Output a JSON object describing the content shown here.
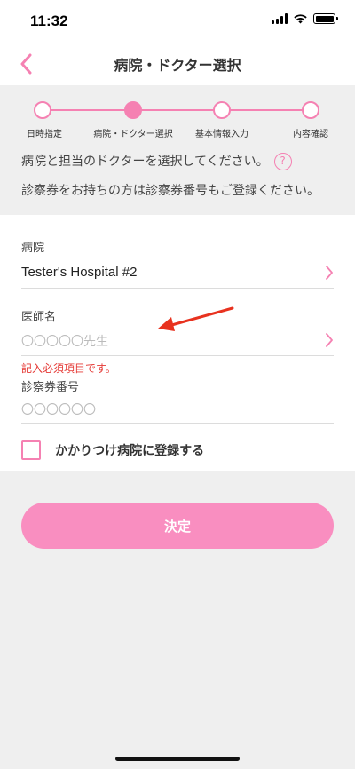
{
  "status_bar": {
    "time": "11:32"
  },
  "nav": {
    "title": "病院・ドクター選択"
  },
  "steps": [
    {
      "label": "日時指定",
      "active": false
    },
    {
      "label": "病院・ドクター選択",
      "active": true
    },
    {
      "label": "基本情報入力",
      "active": false
    },
    {
      "label": "内容確認",
      "active": false
    }
  ],
  "intro": {
    "line1": "病院と担当のドクターを選択してください。",
    "help_symbol": "?",
    "line2": "診察券をお持ちの方は診察券番号もご登録ください。"
  },
  "form": {
    "hospital_label": "病院",
    "hospital_value": "Tester's Hospital #2",
    "doctor_label": "医師名",
    "doctor_placeholder": "〇〇〇〇〇先生",
    "doctor_error": "記入必須項目です。",
    "card_label": "診察券番号",
    "card_placeholder": "〇〇〇〇〇〇",
    "register_label": "かかりつけ病院に登録する"
  },
  "submit_label": "決定",
  "colors": {
    "accent": "#f581b2",
    "button": "#f98ec0",
    "error": "#e53935",
    "annotation_arrow": "#e8321f"
  }
}
